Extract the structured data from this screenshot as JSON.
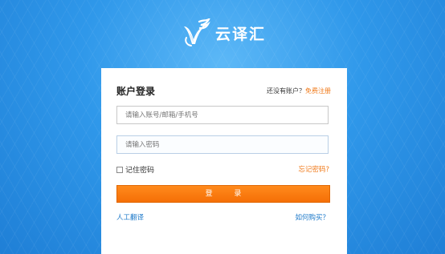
{
  "brand": {
    "name": "云译汇",
    "logo_icon": "yunyihui-logo-icon"
  },
  "login": {
    "title": "账户登录",
    "no_account_text": "还没有账户？",
    "register_link": "免费注册",
    "username_placeholder": "请输入账号/邮箱/手机号",
    "password_placeholder": "请输入密码",
    "remember_label": "记住密码",
    "forgot_link": "忘记密码?",
    "login_button": "登 录",
    "human_translation_link": "人工翻译",
    "how_to_buy_link": "如何购买？"
  },
  "colors": {
    "background": "#2a8fe0",
    "accent_orange": "#f56f06",
    "link_blue": "#1b78c9"
  }
}
